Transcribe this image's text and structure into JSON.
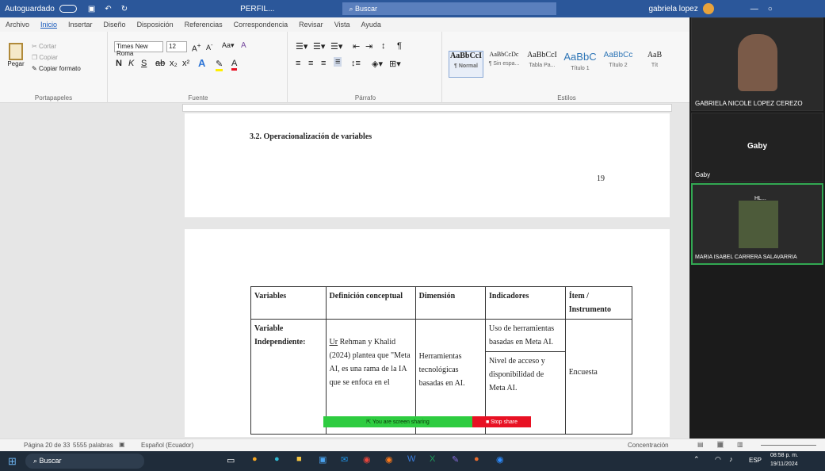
{
  "titlebar": {
    "autosave": "Autoguardado",
    "doc_title": "PERFIL...",
    "search": "Buscar",
    "user": "gabriela lopez"
  },
  "tabs": [
    "Archivo",
    "Inicio",
    "Insertar",
    "Diseño",
    "Disposición",
    "Referencias",
    "Correspondencia",
    "Revisar",
    "Vista",
    "Ayuda"
  ],
  "ribbon": {
    "paste": "Pegar",
    "cut": "Cortar",
    "copy": "Copiar",
    "format_painter": "Copiar formato",
    "clipboard_lbl": "Portapapeles",
    "font_name": "Times New Roma",
    "font_size": "12",
    "font_lbl": "Fuente",
    "paragraph_lbl": "Párrafo",
    "styles_lbl": "Estilos",
    "styles": [
      {
        "preview": "AaBbCcI",
        "name": "¶ Normal"
      },
      {
        "preview": "AaBbCcDc",
        "name": "¶ Sin espa..."
      },
      {
        "preview": "AaBbCcI",
        "name": "Tabla Pa..."
      },
      {
        "preview": "AaBbC",
        "name": "Título 1"
      },
      {
        "preview": "AaBbCc",
        "name": "Título 2"
      },
      {
        "preview": "AaB",
        "name": "Tít"
      }
    ]
  },
  "page1": {
    "heading": "3.2. Operacionalización de variables",
    "page_number": "19"
  },
  "table": {
    "headers": [
      "Variables",
      "Definición conceptual",
      "Dimensión",
      "Indicadores",
      "Ítem / Instrumento"
    ],
    "row": {
      "variable": "Variable Independiente:",
      "definition_link": "Ur",
      "definition_rest": " Rehman y Khalid (2024) plantea que \"Meta AI, es una rama de la IA que se enfoca en el",
      "dimension": "Herramientas tecnológicas basadas en AI.",
      "indicator1": "Uso de herramientas basadas en Meta AI.",
      "indicator2": "Nivel de acceso y disponibilidad de Meta AI.",
      "instrument": "Encuesta"
    }
  },
  "sharebar": {
    "sharing": "You are screen sharing",
    "stop": "Stop share"
  },
  "statusbar": {
    "page": "Página 20 de 33",
    "words": "5555 palabras",
    "lang": "Español (Ecuador)",
    "focus": "Concentración"
  },
  "video": {
    "p1_name": "GABRIELA NICOLE LOPEZ CEREZO",
    "p2_label": "Gaby",
    "p2_name": "Gaby",
    "p3_name": "MARIA ISABEL CARRERA SALAVARRIA",
    "p3_tag": "HL..."
  },
  "taskbar": {
    "search": "Buscar",
    "time": "08:58 p. m.",
    "date": "19/11/2024",
    "lang": "ESP"
  }
}
